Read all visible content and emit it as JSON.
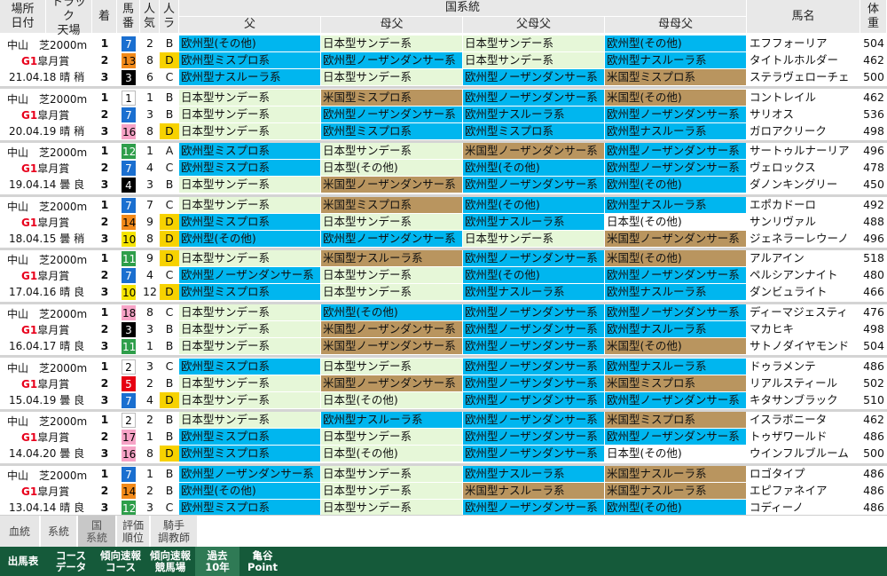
{
  "header": {
    "place_date": "場所\n日付",
    "track": "トラック\n天場",
    "chaku": "着",
    "uma": "馬\n番",
    "ninki": "人\n気",
    "ninka": "人\nラ",
    "kokukeitou": "国系統",
    "father": "父",
    "mother_father": "母父",
    "father_mother_father": "父母父",
    "mother_mother_father": "母母父",
    "horse_name": "馬名",
    "weight": "体\n重"
  },
  "colors": {
    "cyan": "#00b6ef",
    "green": "#e6f7d8",
    "brown": "#b9955f",
    "white": "#ffffff",
    "waku": {
      "1": {
        "bg": "#ffffff",
        "fg": "#000000",
        "border": "#bbbbbb"
      },
      "2": {
        "bg": "#000000",
        "fg": "#ffffff",
        "border": "#000000"
      },
      "3": {
        "bg": "#e60012",
        "fg": "#ffffff",
        "border": "#e60012"
      },
      "4": {
        "bg": "#1a6fd0",
        "fg": "#ffffff",
        "border": "#1a6fd0"
      },
      "5": {
        "bg": "#f5e400",
        "fg": "#000000",
        "border": "#f5e400"
      },
      "6": {
        "bg": "#2e9e4a",
        "fg": "#ffffff",
        "border": "#2e9e4a"
      },
      "7": {
        "bg": "#f28a1a",
        "fg": "#000000",
        "border": "#f28a1a"
      },
      "8": {
        "bg": "#f6a3c6",
        "fg": "#000000",
        "border": "#f6a3c6"
      }
    },
    "rank": {
      "A": "#ffffff",
      "B": "#ffffff",
      "C": "#ffffff",
      "D": "#f7d200"
    }
  },
  "groups": [
    {
      "course": "中山　芝2000m",
      "grade": "G1",
      "race": "皐月賞",
      "date_cond": "21.04.18 晴 稍",
      "rows": [
        {
          "chaku": "1",
          "uma": "7",
          "waku": "4",
          "ninki": "2",
          "rank": "B",
          "ped": [
            [
              "欧州型(その他)",
              "cyan"
            ],
            [
              "日本型サンデー系",
              "green"
            ],
            [
              "日本型サンデー系",
              "green"
            ],
            [
              "欧州型(その他)",
              "cyan"
            ]
          ],
          "name": "エフフォーリア",
          "weight": "504"
        },
        {
          "chaku": "2",
          "uma": "13",
          "waku": "7",
          "ninki": "8",
          "rank": "D",
          "ped": [
            [
              "欧州型ミスプロ系",
              "cyan"
            ],
            [
              "欧州型ノーザンダンサー系",
              "cyan"
            ],
            [
              "日本型サンデー系",
              "green"
            ],
            [
              "欧州型ナスルーラ系",
              "cyan"
            ]
          ],
          "name": "タイトルホルダー",
          "weight": "462"
        },
        {
          "chaku": "3",
          "uma": "3",
          "waku": "2",
          "ninki": "6",
          "rank": "C",
          "ped": [
            [
              "欧州型ナスルーラ系",
              "cyan"
            ],
            [
              "日本型サンデー系",
              "green"
            ],
            [
              "欧州型ノーザンダンサー系",
              "cyan"
            ],
            [
              "米国型ミスプロ系",
              "brown"
            ]
          ],
          "name": "ステラヴェローチェ",
          "weight": "500"
        }
      ]
    },
    {
      "course": "中山　芝2000m",
      "grade": "G1",
      "race": "皐月賞",
      "date_cond": "20.04.19 晴 稍",
      "rows": [
        {
          "chaku": "1",
          "uma": "1",
          "waku": "1",
          "ninki": "1",
          "rank": "B",
          "ped": [
            [
              "日本型サンデー系",
              "green"
            ],
            [
              "米国型ミスプロ系",
              "brown"
            ],
            [
              "欧州型ノーザンダンサー系",
              "cyan"
            ],
            [
              "米国型(その他)",
              "brown"
            ]
          ],
          "name": "コントレイル",
          "weight": "462"
        },
        {
          "chaku": "2",
          "uma": "7",
          "waku": "4",
          "ninki": "3",
          "rank": "B",
          "ped": [
            [
              "日本型サンデー系",
              "green"
            ],
            [
              "欧州型ノーザンダンサー系",
              "cyan"
            ],
            [
              "欧州型ナスルーラ系",
              "cyan"
            ],
            [
              "欧州型ノーザンダンサー系",
              "cyan"
            ]
          ],
          "name": "サリオス",
          "weight": "536"
        },
        {
          "chaku": "3",
          "uma": "16",
          "waku": "8",
          "ninki": "8",
          "rank": "D",
          "ped": [
            [
              "日本型サンデー系",
              "green"
            ],
            [
              "欧州型ミスプロ系",
              "cyan"
            ],
            [
              "欧州型ミスプロ系",
              "cyan"
            ],
            [
              "欧州型ナスルーラ系",
              "cyan"
            ]
          ],
          "name": "ガロアクリーク",
          "weight": "498"
        }
      ]
    },
    {
      "course": "中山　芝2000m",
      "grade": "G1",
      "race": "皐月賞",
      "date_cond": "19.04.14 曇 良",
      "rows": [
        {
          "chaku": "1",
          "uma": "12",
          "waku": "6",
          "ninki": "1",
          "rank": "A",
          "ped": [
            [
              "欧州型ミスプロ系",
              "cyan"
            ],
            [
              "日本型サンデー系",
              "green"
            ],
            [
              "米国型ノーザンダンサー系",
              "brown"
            ],
            [
              "欧州型ノーザンダンサー系",
              "cyan"
            ]
          ],
          "name": "サートゥルナーリア",
          "weight": "496"
        },
        {
          "chaku": "2",
          "uma": "7",
          "waku": "4",
          "ninki": "4",
          "rank": "C",
          "ped": [
            [
              "欧州型ミスプロ系",
              "cyan"
            ],
            [
              "日本型(その他)",
              "green"
            ],
            [
              "欧州型(その他)",
              "cyan"
            ],
            [
              "欧州型ノーザンダンサー系",
              "cyan"
            ]
          ],
          "name": "ヴェロックス",
          "weight": "478"
        },
        {
          "chaku": "3",
          "uma": "4",
          "waku": "2",
          "ninki": "3",
          "rank": "B",
          "ped": [
            [
              "日本型サンデー系",
              "green"
            ],
            [
              "米国型ノーザンダンサー系",
              "brown"
            ],
            [
              "欧州型ノーザンダンサー系",
              "cyan"
            ],
            [
              "欧州型(その他)",
              "cyan"
            ]
          ],
          "name": "ダノンキングリー",
          "weight": "450"
        }
      ]
    },
    {
      "course": "中山　芝2000m",
      "grade": "G1",
      "race": "皐月賞",
      "date_cond": "18.04.15 曇 稍",
      "rows": [
        {
          "chaku": "1",
          "uma": "7",
          "waku": "4",
          "ninki": "7",
          "rank": "C",
          "ped": [
            [
              "日本型サンデー系",
              "green"
            ],
            [
              "米国型ミスプロ系",
              "brown"
            ],
            [
              "欧州型(その他)",
              "cyan"
            ],
            [
              "欧州型ナスルーラ系",
              "cyan"
            ]
          ],
          "name": "エポカドーロ",
          "weight": "492"
        },
        {
          "chaku": "2",
          "uma": "14",
          "waku": "7",
          "ninki": "9",
          "rank": "D",
          "ped": [
            [
              "欧州型ミスプロ系",
              "cyan"
            ],
            [
              "日本型サンデー系",
              "green"
            ],
            [
              "欧州型ナスルーラ系",
              "cyan"
            ],
            [
              "日本型(その他)",
              "white"
            ]
          ],
          "name": "サンリヴァル",
          "weight": "488"
        },
        {
          "chaku": "3",
          "uma": "10",
          "waku": "5",
          "ninki": "8",
          "rank": "D",
          "ped": [
            [
              "欧州型(その他)",
              "cyan"
            ],
            [
              "欧州型ノーザンダンサー系",
              "cyan"
            ],
            [
              "日本型サンデー系",
              "green"
            ],
            [
              "米国型ノーザンダンサー系",
              "brown"
            ]
          ],
          "name": "ジェネラーレウーノ",
          "weight": "496"
        }
      ]
    },
    {
      "course": "中山　芝2000m",
      "grade": "G1",
      "race": "皐月賞",
      "date_cond": "17.04.16 晴 良",
      "rows": [
        {
          "chaku": "1",
          "uma": "11",
          "waku": "6",
          "ninki": "9",
          "rank": "D",
          "ped": [
            [
              "日本型サンデー系",
              "green"
            ],
            [
              "米国型ナスルーラ系",
              "brown"
            ],
            [
              "欧州型ノーザンダンサー系",
              "cyan"
            ],
            [
              "米国型(その他)",
              "brown"
            ]
          ],
          "name": "アルアイン",
          "weight": "518"
        },
        {
          "chaku": "2",
          "uma": "7",
          "waku": "4",
          "ninki": "4",
          "rank": "C",
          "ped": [
            [
              "欧州型ノーザンダンサー系",
              "cyan"
            ],
            [
              "日本型サンデー系",
              "green"
            ],
            [
              "欧州型(その他)",
              "cyan"
            ],
            [
              "欧州型ノーザンダンサー系",
              "cyan"
            ]
          ],
          "name": "ペルシアンナイト",
          "weight": "480"
        },
        {
          "chaku": "3",
          "uma": "10",
          "waku": "5",
          "ninki": "12",
          "rank": "D",
          "ped": [
            [
              "欧州型ミスプロ系",
              "cyan"
            ],
            [
              "日本型サンデー系",
              "green"
            ],
            [
              "欧州型ナスルーラ系",
              "cyan"
            ],
            [
              "欧州型ナスルーラ系",
              "cyan"
            ]
          ],
          "name": "ダンビュライト",
          "weight": "466"
        }
      ]
    },
    {
      "course": "中山　芝2000m",
      "grade": "G1",
      "race": "皐月賞",
      "date_cond": "16.04.17 晴 良",
      "rows": [
        {
          "chaku": "1",
          "uma": "18",
          "waku": "8",
          "ninki": "8",
          "rank": "C",
          "ped": [
            [
              "日本型サンデー系",
              "green"
            ],
            [
              "欧州型(その他)",
              "cyan"
            ],
            [
              "欧州型ノーザンダンサー系",
              "cyan"
            ],
            [
              "欧州型ノーザンダンサー系",
              "cyan"
            ]
          ],
          "name": "ディーマジェスティ",
          "weight": "476"
        },
        {
          "chaku": "2",
          "uma": "3",
          "waku": "2",
          "ninki": "3",
          "rank": "B",
          "ped": [
            [
              "日本型サンデー系",
              "green"
            ],
            [
              "米国型ノーザンダンサー系",
              "brown"
            ],
            [
              "欧州型ノーザンダンサー系",
              "cyan"
            ],
            [
              "欧州型ナスルーラ系",
              "cyan"
            ]
          ],
          "name": "マカヒキ",
          "weight": "498"
        },
        {
          "chaku": "3",
          "uma": "11",
          "waku": "6",
          "ninki": "1",
          "rank": "B",
          "ped": [
            [
              "日本型サンデー系",
              "green"
            ],
            [
              "米国型ノーザンダンサー系",
              "brown"
            ],
            [
              "欧州型ノーザンダンサー系",
              "cyan"
            ],
            [
              "米国型(その他)",
              "brown"
            ]
          ],
          "name": "サトノダイヤモンド",
          "weight": "504"
        }
      ]
    },
    {
      "course": "中山　芝2000m",
      "grade": "G1",
      "race": "皐月賞",
      "date_cond": "15.04.19 曇 良",
      "rows": [
        {
          "chaku": "1",
          "uma": "2",
          "waku": "1",
          "ninki": "3",
          "rank": "C",
          "ped": [
            [
              "欧州型ミスプロ系",
              "cyan"
            ],
            [
              "日本型サンデー系",
              "green"
            ],
            [
              "欧州型ノーザンダンサー系",
              "cyan"
            ],
            [
              "欧州型ナスルーラ系",
              "cyan"
            ]
          ],
          "name": "ドゥラメンテ",
          "weight": "486"
        },
        {
          "chaku": "2",
          "uma": "5",
          "waku": "3",
          "ninki": "2",
          "rank": "B",
          "ped": [
            [
              "日本型サンデー系",
              "green"
            ],
            [
              "米国型ノーザンダンサー系",
              "brown"
            ],
            [
              "欧州型ノーザンダンサー系",
              "cyan"
            ],
            [
              "米国型ミスプロ系",
              "brown"
            ]
          ],
          "name": "リアルスティール",
          "weight": "502"
        },
        {
          "chaku": "3",
          "uma": "7",
          "waku": "4",
          "ninki": "4",
          "rank": "D",
          "ped": [
            [
              "日本型サンデー系",
              "green"
            ],
            [
              "日本型(その他)",
              "green"
            ],
            [
              "欧州型ノーザンダンサー系",
              "cyan"
            ],
            [
              "欧州型ノーザンダンサー系",
              "cyan"
            ]
          ],
          "name": "キタサンブラック",
          "weight": "510"
        }
      ]
    },
    {
      "course": "中山　芝2000m",
      "grade": "G1",
      "race": "皐月賞",
      "date_cond": "14.04.20 曇 良",
      "rows": [
        {
          "chaku": "1",
          "uma": "2",
          "waku": "1",
          "ninki": "2",
          "rank": "B",
          "ped": [
            [
              "日本型サンデー系",
              "green"
            ],
            [
              "欧州型ナスルーラ系",
              "cyan"
            ],
            [
              "欧州型ノーザンダンサー系",
              "cyan"
            ],
            [
              "米国型ミスプロ系",
              "brown"
            ]
          ],
          "name": "イスラボニータ",
          "weight": "462"
        },
        {
          "chaku": "2",
          "uma": "17",
          "waku": "8",
          "ninki": "1",
          "rank": "B",
          "ped": [
            [
              "欧州型ミスプロ系",
              "cyan"
            ],
            [
              "日本型サンデー系",
              "green"
            ],
            [
              "欧州型ノーザンダンサー系",
              "cyan"
            ],
            [
              "欧州型ノーザンダンサー系",
              "cyan"
            ]
          ],
          "name": "トゥザワールド",
          "weight": "486"
        },
        {
          "chaku": "3",
          "uma": "16",
          "waku": "8",
          "ninki": "8",
          "rank": "D",
          "ped": [
            [
              "欧州型ミスプロ系",
              "cyan"
            ],
            [
              "日本型(その他)",
              "green"
            ],
            [
              "欧州型ノーザンダンサー系",
              "cyan"
            ],
            [
              "日本型(その他)",
              "white"
            ]
          ],
          "name": "ウインフルブルーム",
          "weight": "500"
        }
      ]
    },
    {
      "course": "中山　芝2000m",
      "grade": "G1",
      "race": "皐月賞",
      "date_cond": "13.04.14 晴 良",
      "rows": [
        {
          "chaku": "1",
          "uma": "7",
          "waku": "4",
          "ninki": "1",
          "rank": "B",
          "ped": [
            [
              "欧州型ノーザンダンサー系",
              "cyan"
            ],
            [
              "日本型サンデー系",
              "green"
            ],
            [
              "欧州型ナスルーラ系",
              "cyan"
            ],
            [
              "米国型ナスルーラ系",
              "brown"
            ]
          ],
          "name": "ロゴタイプ",
          "weight": "486"
        },
        {
          "chaku": "2",
          "uma": "14",
          "waku": "7",
          "ninki": "2",
          "rank": "B",
          "ped": [
            [
              "欧州型(その他)",
              "cyan"
            ],
            [
              "日本型サンデー系",
              "green"
            ],
            [
              "米国型ナスルーラ系",
              "brown"
            ],
            [
              "米国型ナスルーラ系",
              "brown"
            ]
          ],
          "name": "エピファネイア",
          "weight": "486"
        },
        {
          "chaku": "3",
          "uma": "12",
          "waku": "6",
          "ninki": "3",
          "rank": "C",
          "ped": [
            [
              "欧州型ミスプロ系",
              "cyan"
            ],
            [
              "日本型サンデー系",
              "green"
            ],
            [
              "欧州型ノーザンダンサー系",
              "cyan"
            ],
            [
              "欧州型(その他)",
              "cyan"
            ]
          ],
          "name": "コディーノ",
          "weight": "486"
        }
      ]
    }
  ],
  "tabs_row1": [
    {
      "label": "血統",
      "active": false
    },
    {
      "label": "系統",
      "active": false
    },
    {
      "label": "国\n系統",
      "active": true
    },
    {
      "label": "評価\n順位",
      "active": false
    },
    {
      "label": "騎手\n調教師",
      "active": false
    }
  ],
  "tabs_row2": [
    {
      "label": "出馬表",
      "active": false
    },
    {
      "label": "コース\nデータ",
      "active": false
    },
    {
      "label": "傾向速報\nコース",
      "active": false
    },
    {
      "label": "傾向速報\n競馬場",
      "active": false
    },
    {
      "label": "過去\n10年",
      "active": true
    },
    {
      "label": "亀谷\nPoint",
      "active": false
    }
  ]
}
